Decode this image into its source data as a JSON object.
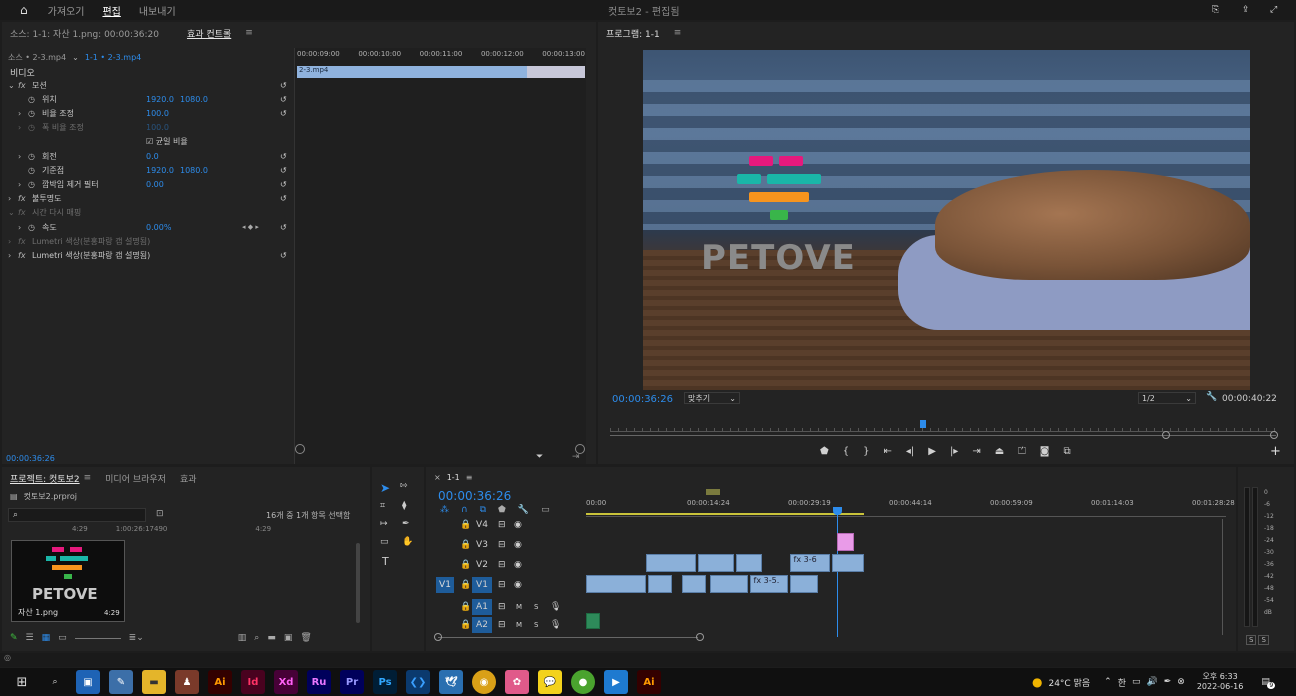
{
  "topbar": {
    "tabs": [
      "가져오기",
      "편집",
      "내보내기"
    ],
    "active_tab": "편집",
    "title": "컷토보2 - 편집됨"
  },
  "source_panel": {
    "tabs": [
      "소스: 1-1: 자산 1.png: 00:00:36:20",
      "효과 컨트롤"
    ],
    "active_tab": "효과 컨트롤",
    "source_label": "소스 • 2-3.mp4",
    "sequence_label": "1-1 • 2-3.mp4",
    "ruler": [
      "00:00:09:00",
      "00:00:10:00",
      "00:00:11:00",
      "00:00:12:00",
      "00:00:13:00"
    ],
    "clip_name": "2-3.mp4",
    "section": "비디오",
    "rows": [
      {
        "indent": 0,
        "expander": "⌄",
        "fx": "fx",
        "label": "모션",
        "v1": "",
        "v2": ""
      },
      {
        "indent": 1,
        "expander": "",
        "fx": "◷",
        "label": "위치",
        "v1": "1920.0",
        "v2": "1080.0"
      },
      {
        "indent": 1,
        "expander": "›",
        "fx": "◷",
        "label": "비율 조정",
        "v1": "100.0",
        "v2": ""
      },
      {
        "indent": 1,
        "expander": "›",
        "fx": "◷",
        "label": "폭 비율 조정",
        "v1": "100.0",
        "v2": "",
        "dim": true
      },
      {
        "indent": 1,
        "expander": "",
        "fx": "",
        "label": "",
        "v1": "☑ 균일 비율",
        "v2": ""
      },
      {
        "indent": 1,
        "expander": "›",
        "fx": "◷",
        "label": "회전",
        "v1": "0.0",
        "v2": ""
      },
      {
        "indent": 1,
        "expander": "",
        "fx": "◷",
        "label": "기준점",
        "v1": "1920.0",
        "v2": "1080.0"
      },
      {
        "indent": 1,
        "expander": "›",
        "fx": "◷",
        "label": "깜박임 제거 필터",
        "v1": "0.00",
        "v2": ""
      },
      {
        "indent": 0,
        "expander": "›",
        "fx": "fx",
        "label": "불투명도",
        "v1": "",
        "v2": ""
      },
      {
        "indent": 0,
        "expander": "⌄",
        "fx": "fx",
        "label": "시간 다시 매핑",
        "v1": "",
        "v2": "",
        "dim": true
      },
      {
        "indent": 1,
        "expander": "›",
        "fx": "◷",
        "label": "속도",
        "v1": "0.00%",
        "v2": ""
      },
      {
        "indent": 0,
        "expander": "›",
        "fx": "fx",
        "label": "Lumetri 색상(분홍파랑 갭 설명됨)",
        "v1": "",
        "v2": "",
        "dim": true
      },
      {
        "indent": 0,
        "expander": "›",
        "fx": "fx",
        "label": "Lumetri 색상(분홍파랑 갭 설명됨)",
        "v1": "",
        "v2": ""
      }
    ],
    "timecode": "00:00:36:26"
  },
  "program_panel": {
    "title": "프로그램: 1-1",
    "video_text": "PETOVE",
    "timecode": "00:00:36:26",
    "fit": "맞추기",
    "resolution": "1/2",
    "duration": "00:00:40:22"
  },
  "project_panel": {
    "tabs": [
      "프로젝트: 컷토보2",
      "미디어 브라우저",
      "효과"
    ],
    "project_file": "컷토보2.prproj",
    "item_count": "16개 중 1개 항목 선택함",
    "columns": [
      "4:29",
      "1:00:26:17490",
      "4:29"
    ],
    "thumb_name": "자산 1.png",
    "thumb_duration": "4:29",
    "thumb_text": "PETOVE"
  },
  "timeline": {
    "sequence": "1-1",
    "timecode": "00:00:36:26",
    "ruler": [
      "00:00",
      "00:00:14:24",
      "00:00:29:19",
      "00:00:44:14",
      "00:00:59:09",
      "00:01:14:03",
      "00:01:28:28"
    ],
    "tracks": [
      "V4",
      "V3",
      "V2",
      "V1",
      "A1",
      "A2"
    ],
    "clip_labels": [
      "3-6",
      "3-5."
    ],
    "audio_scale": [
      "0",
      "-6",
      "-12",
      "-18",
      "-24",
      "-30",
      "-36",
      "-42",
      "-48",
      "-54",
      "dB"
    ]
  },
  "taskbar": {
    "apps": [
      {
        "name": "Ai",
        "color": "#330000",
        "fg": "#ff9a00"
      },
      {
        "name": "Id",
        "color": "#49021f",
        "fg": "#ff3366"
      },
      {
        "name": "Xd",
        "color": "#470137",
        "fg": "#ff61f6"
      },
      {
        "name": "Ru",
        "color": "#00005b",
        "fg": "#ea77ff"
      },
      {
        "name": "Pr",
        "color": "#00005b",
        "fg": "#9999ff"
      },
      {
        "name": "Ps",
        "color": "#001e36",
        "fg": "#31a8ff"
      }
    ],
    "weather": "24°C 맑음",
    "time": "오후 6:33",
    "date": "2022-06-16",
    "notif_count": "9"
  }
}
